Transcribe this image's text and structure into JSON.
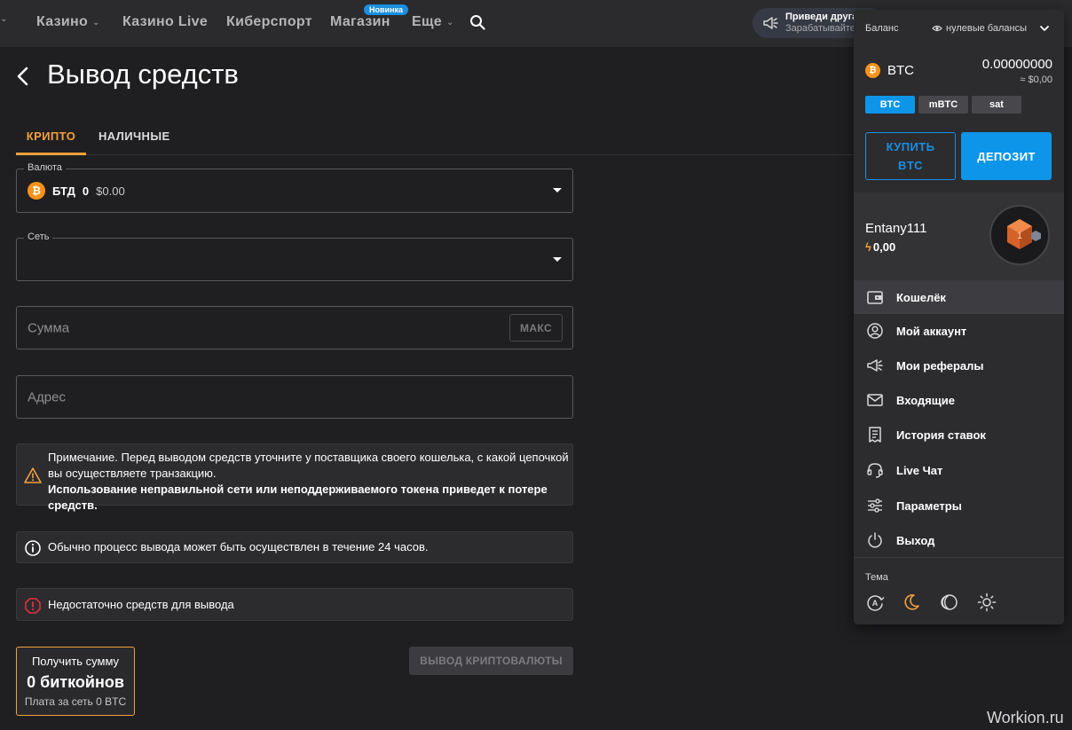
{
  "nav": {
    "items": [
      {
        "label": "Казино",
        "chevron": true
      },
      {
        "label": "Казино Live",
        "chevron": false
      },
      {
        "label": "Киберспорт",
        "chevron": false
      },
      {
        "label": "Магазин",
        "chevron": false
      },
      {
        "label": "Еще",
        "chevron": true
      }
    ],
    "shop_badge": "Новинка",
    "promo_title": "Приведи друга",
    "promo_sub": "Зарабатывайте"
  },
  "page": {
    "title": "Вывод средств",
    "tabs": [
      "КРИПТО",
      "НАЛИЧНЫЕ"
    ]
  },
  "form": {
    "currency_legend": "Валюта",
    "currency_code": "БТД",
    "currency_amount": "0",
    "currency_usd": "$0.00",
    "network_legend": "Сеть",
    "amount_placeholder": "Сумма",
    "max_label": "МАКС",
    "address_placeholder": "Адрес"
  },
  "notices": {
    "note_line1": "Примечание. Перед выводом средств уточните у поставщика своего кошелька, с какой цепочкой",
    "note_line2": "вы осуществляете транзакцию.",
    "note_line3": "Использование неправильной сети или неподдерживаемого токена приведет к потере средств.",
    "info": "Обычно процесс вывода может быть осуществлен в течение 24 часов.",
    "error": "Недостаточно средств для вывода"
  },
  "receive": {
    "label": "Получить сумму",
    "amount": "0 биткойнов",
    "fee": "Плата за сеть 0 BTC"
  },
  "withdraw_button": "ВЫВОД КРИПТОВАЛЮТЫ",
  "watermark": "Workion.ru",
  "panel": {
    "balance_label": "Баланс",
    "zero_balances": "нулевые балансы",
    "coin": "BTC",
    "coin_value": "0.00000000",
    "coin_usd": "≈ $0,00",
    "units": [
      "BTC",
      "mBTC",
      "sat"
    ],
    "buy_label_1": "КУПИТЬ",
    "buy_label_2": "BTC",
    "deposit_label": "ДЕПОЗИТ",
    "username": "Entany111",
    "points": "0,00",
    "menu": [
      {
        "label": "Кошелёк",
        "icon": "wallet-icon"
      },
      {
        "label": "Мой аккаунт",
        "icon": "user-icon"
      },
      {
        "label": "Мои рефералы",
        "icon": "megaphone-icon"
      },
      {
        "label": "Входящие",
        "icon": "mail-icon"
      },
      {
        "label": "История ставок",
        "icon": "receipt-icon"
      },
      {
        "label": "Live Чат",
        "icon": "headset-icon"
      },
      {
        "label": "Параметры",
        "icon": "sliders-icon"
      },
      {
        "label": "Выход",
        "icon": "power-icon"
      }
    ],
    "theme_label": "Тема"
  },
  "colors": {
    "accent": "#f2a03d",
    "primary": "#0d95ea",
    "background": "#1f1f21"
  }
}
